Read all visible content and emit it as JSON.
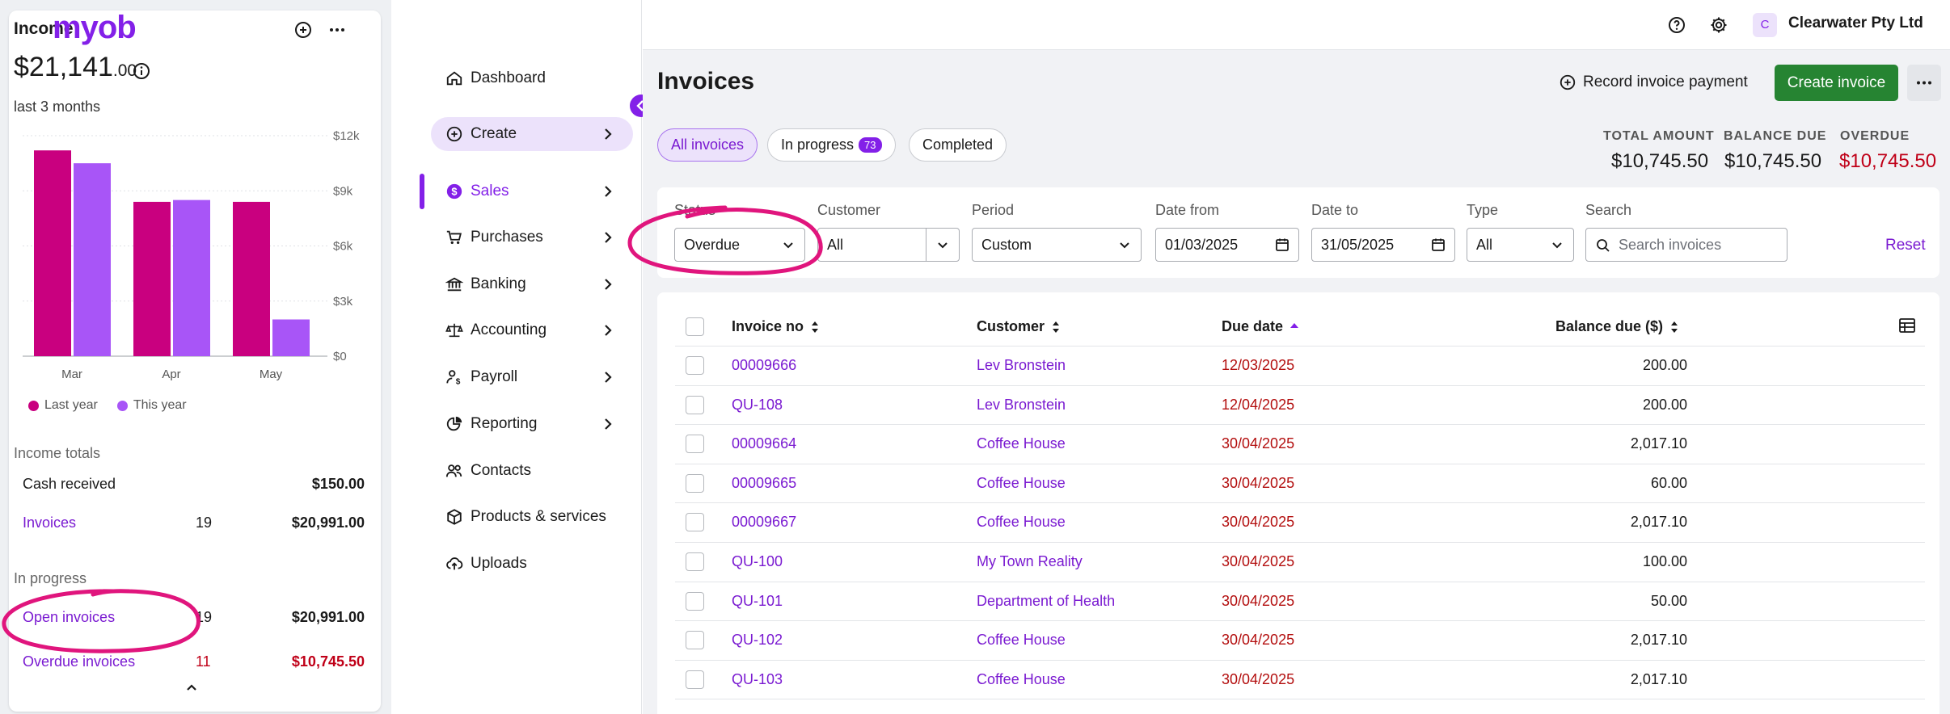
{
  "income": {
    "title": "Income",
    "amount_main": "$21,141",
    "amount_cents": ".00",
    "period": "last 3 months",
    "legend": [
      "Last year",
      "This year"
    ],
    "totals_heading": "Income totals",
    "cash_received_label": "Cash received",
    "cash_received_amount": "$150.00",
    "invoices_label": "Invoices",
    "invoices_count": "19",
    "invoices_amount": "$20,991.00",
    "in_progress_heading": "In progress",
    "open_invoices_label": "Open invoices",
    "open_invoices_count": "19",
    "open_invoices_amount": "$20,991.00",
    "overdue_invoices_label": "Overdue invoices",
    "overdue_invoices_count": "11",
    "overdue_invoices_amount": "$10,745.50",
    "colors": {
      "last_year": "#c9007f",
      "this_year": "#a855f7"
    }
  },
  "chart_data": {
    "type": "bar",
    "categories": [
      "Mar",
      "Apr",
      "May"
    ],
    "series": [
      {
        "name": "Last year",
        "values": [
          11200,
          8400,
          8400
        ]
      },
      {
        "name": "This year",
        "values": [
          10500,
          8500,
          2000
        ]
      }
    ],
    "y_ticks": [
      "$0",
      "$3k",
      "$6k",
      "$9k",
      "$12k"
    ],
    "ylim": [
      0,
      12000
    ]
  },
  "nav": {
    "logo": "myob",
    "items": [
      {
        "label": "Dashboard",
        "icon": "home-icon",
        "chevron": false
      },
      {
        "label": "Create",
        "icon": "plus-circle-icon",
        "chevron": true
      },
      {
        "label": "Sales",
        "icon": "dollar-icon",
        "chevron": true
      },
      {
        "label": "Purchases",
        "icon": "cart-icon",
        "chevron": true
      },
      {
        "label": "Banking",
        "icon": "bank-icon",
        "chevron": true
      },
      {
        "label": "Accounting",
        "icon": "scales-icon",
        "chevron": true
      },
      {
        "label": "Payroll",
        "icon": "person-dollar-icon",
        "chevron": true
      },
      {
        "label": "Reporting",
        "icon": "pie-chart-icon",
        "chevron": true
      },
      {
        "label": "Contacts",
        "icon": "contacts-icon",
        "chevron": false
      },
      {
        "label": "Products & services",
        "icon": "box-icon",
        "chevron": false
      },
      {
        "label": "Uploads",
        "icon": "cloud-upload-icon",
        "chevron": false
      }
    ],
    "accent": "#8320e8"
  },
  "topbar": {
    "company_initial": "C",
    "company_name": "Clearwater Pty Ltd"
  },
  "page": {
    "title": "Invoices",
    "record_payment": "Record invoice payment",
    "create_invoice": "Create invoice",
    "tabs": {
      "all": "All invoices",
      "in_progress": "In progress",
      "in_progress_count": "73",
      "completed": "Completed"
    },
    "summary": {
      "total_label": "TOTAL AMOUNT",
      "total_value": "$10,745.50",
      "balance_label": "BALANCE DUE",
      "balance_value": "$10,745.50",
      "overdue_label": "OVERDUE",
      "overdue_value": "$10,745.50"
    }
  },
  "filters": {
    "status_label": "Status",
    "status_value": "Overdue",
    "customer_label": "Customer",
    "customer_value": "All",
    "period_label": "Period",
    "period_value": "Custom",
    "date_from_label": "Date from",
    "date_from_value": "01/03/2025",
    "date_to_label": "Date to",
    "date_to_value": "31/05/2025",
    "type_label": "Type",
    "type_value": "All",
    "search_label": "Search",
    "search_placeholder": "Search invoices",
    "reset": "Reset"
  },
  "table": {
    "headers": {
      "invoice_no": "Invoice no",
      "customer": "Customer",
      "due_date": "Due date",
      "balance_due": "Balance due ($)"
    },
    "rows": [
      {
        "invoice_no": "00009666",
        "customer": "Lev Bronstein",
        "due_date": "12/03/2025",
        "balance": "200.00"
      },
      {
        "invoice_no": "QU-108",
        "customer": "Lev Bronstein",
        "due_date": "12/04/2025",
        "balance": "200.00"
      },
      {
        "invoice_no": "00009664",
        "customer": "Coffee House",
        "due_date": "30/04/2025",
        "balance": "2,017.10"
      },
      {
        "invoice_no": "00009665",
        "customer": "Coffee House",
        "due_date": "30/04/2025",
        "balance": "60.00"
      },
      {
        "invoice_no": "00009667",
        "customer": "Coffee House",
        "due_date": "30/04/2025",
        "balance": "2,017.10"
      },
      {
        "invoice_no": "QU-100",
        "customer": "My Town Reality",
        "due_date": "30/04/2025",
        "balance": "100.00"
      },
      {
        "invoice_no": "QU-101",
        "customer": "Department of Health",
        "due_date": "30/04/2025",
        "balance": "50.00"
      },
      {
        "invoice_no": "QU-102",
        "customer": "Coffee House",
        "due_date": "30/04/2025",
        "balance": "2,017.10"
      },
      {
        "invoice_no": "QU-103",
        "customer": "Coffee House",
        "due_date": "30/04/2025",
        "balance": "2,017.10"
      }
    ]
  }
}
